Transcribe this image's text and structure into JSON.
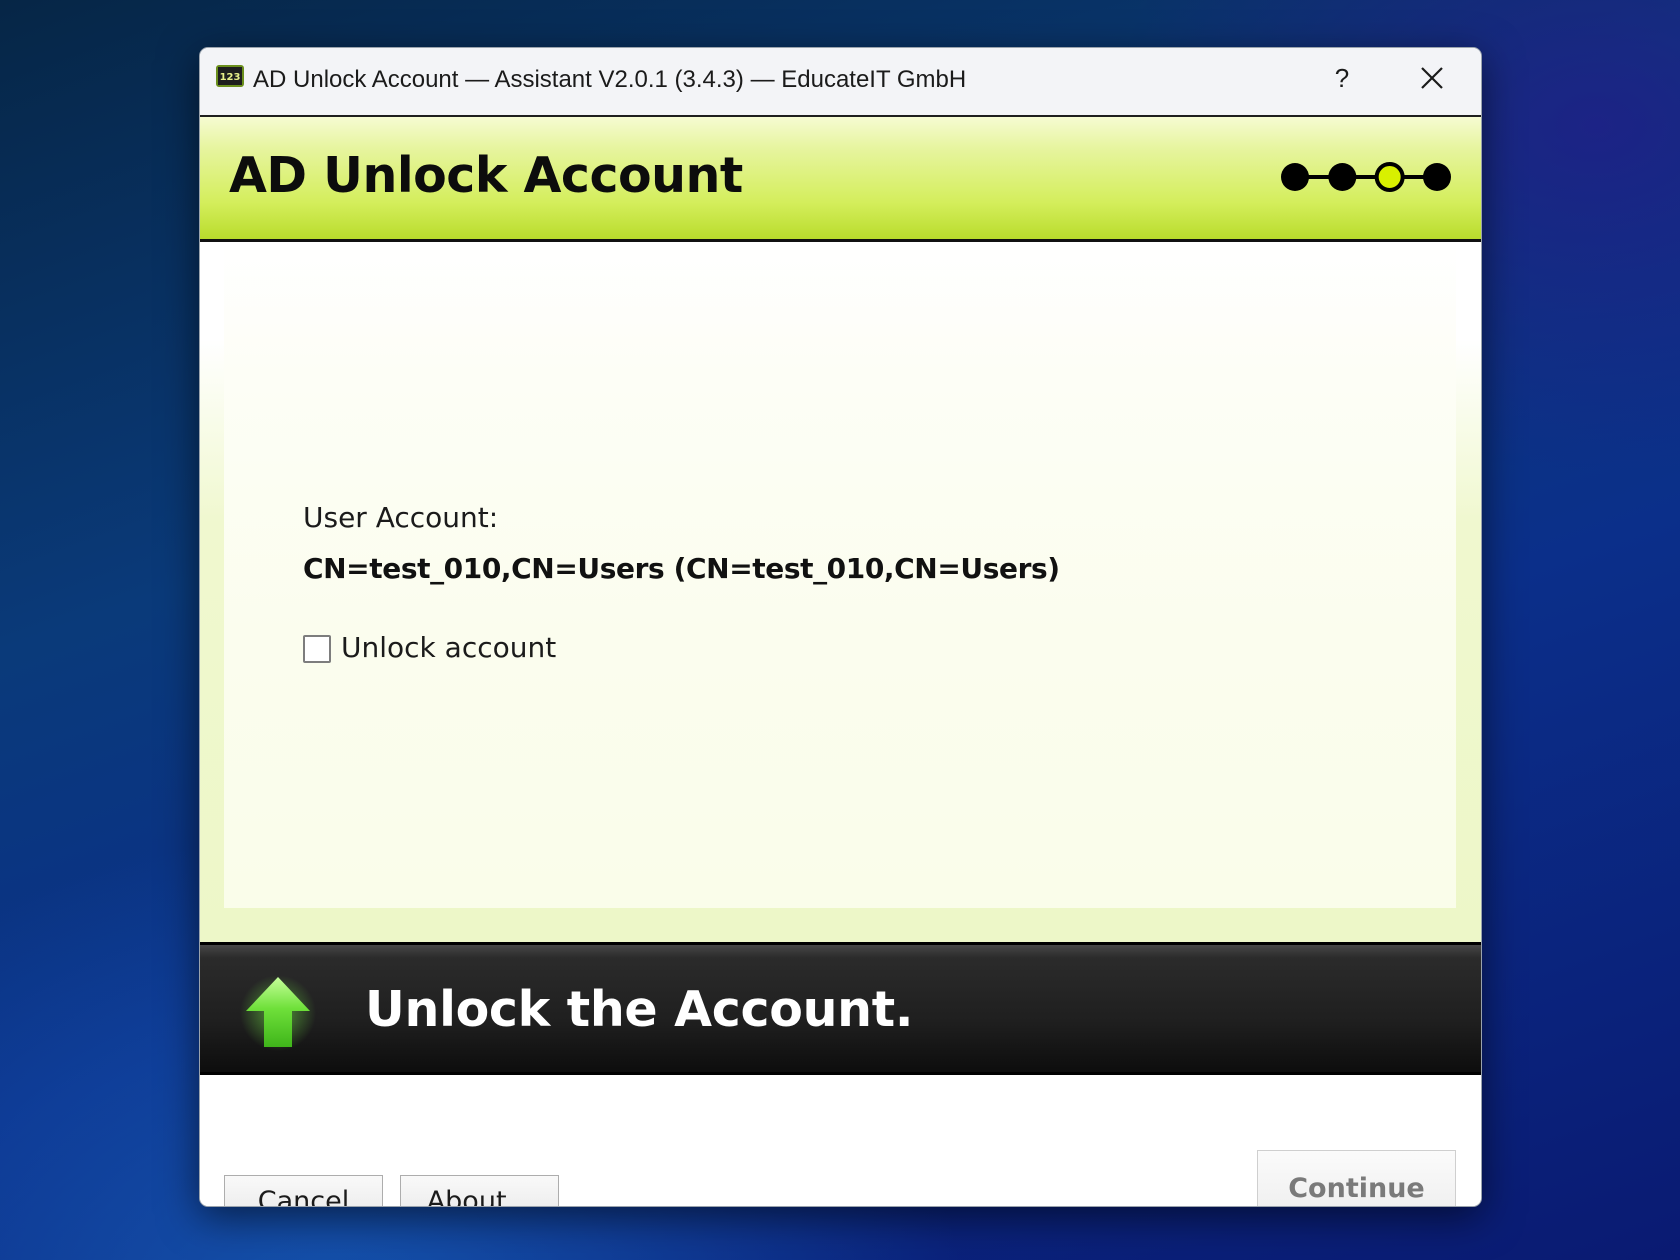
{
  "window": {
    "title": "AD Unlock Account — Assistant V2.0.1 (3.4.3) — EducateIT GmbH",
    "app_icon_text": "123",
    "help_label": "?"
  },
  "header": {
    "title": "AD Unlock Account",
    "steps": {
      "total": 4,
      "current": 3
    }
  },
  "content": {
    "user_account_label": "User Account:",
    "user_account_value": "CN=test_010,CN=Users (CN=test_010,CN=Users)",
    "unlock_checkbox_label": "Unlock account",
    "unlock_checked": false
  },
  "banner": {
    "text": "Unlock the Account.",
    "icon": "green-up-arrow-icon"
  },
  "footer": {
    "cancel_label": "Cancel",
    "about_label": "About...",
    "continue_label": "Continue"
  },
  "colors": {
    "header_accent": "#d4ee5c",
    "current_step": "#d8f000",
    "banner_bg": "#1f1f1f",
    "arrow_green": "#6fe03a"
  }
}
